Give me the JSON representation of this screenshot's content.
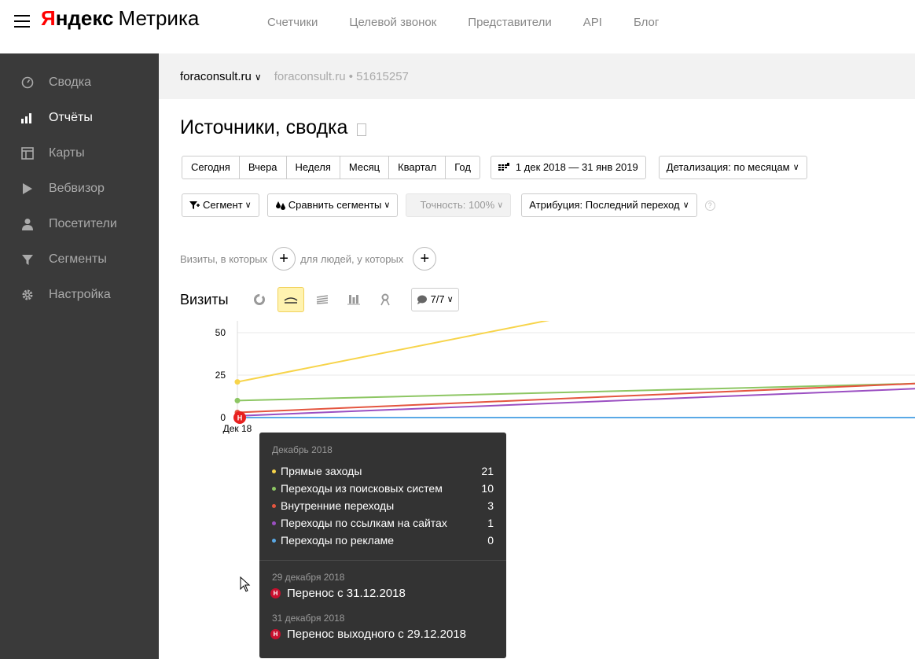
{
  "header": {
    "logo_ya": "Я",
    "logo_ndex": "ндекс",
    "logo_product": "Метрика",
    "nav": [
      "Счетчики",
      "Целевой звонок",
      "Представители",
      "API",
      "Блог"
    ]
  },
  "sidebar": {
    "items": [
      {
        "label": "Сводка",
        "icon": "gauge-icon",
        "active": false
      },
      {
        "label": "Отчёты",
        "icon": "bar-chart-icon",
        "active": true
      },
      {
        "label": "Карты",
        "icon": "map-icon",
        "active": false
      },
      {
        "label": "Вебвизор",
        "icon": "play-icon",
        "active": false
      },
      {
        "label": "Посетители",
        "icon": "person-icon",
        "active": false
      },
      {
        "label": "Сегменты",
        "icon": "funnel-icon",
        "active": false
      },
      {
        "label": "Настройка",
        "icon": "gear-icon",
        "active": false
      }
    ]
  },
  "counter": {
    "name": "foraconsult.ru",
    "info": "foraconsult.ru • 51615257"
  },
  "page": {
    "title": "Источники, сводка"
  },
  "periods": [
    "Сегодня",
    "Вчера",
    "Неделя",
    "Месяц",
    "Квартал",
    "Год"
  ],
  "date_range": "1 дек 2018 — 31 янв 2019",
  "detail": "Детализация: по месяцам",
  "filters": {
    "segment": "Сегмент",
    "compare": "Сравнить сегменты",
    "accuracy": "Точность: 100%",
    "attribution": "Атрибуция: Последний переход"
  },
  "conditions": {
    "visits_label": "Визиты, в которых",
    "people_label": "для людей, у которых"
  },
  "chart_toolbar": {
    "title": "Визиты",
    "series_count": "7/7"
  },
  "colors": {
    "direct": "#f7d44a",
    "search": "#8dc663",
    "internal": "#e4553f",
    "links": "#9b4fc2",
    "ads": "#5aa9e6",
    "sidebar_bg": "#3a3a3a",
    "highlight": "#fff3b0"
  },
  "chart_data": {
    "type": "line",
    "ylim": [
      0,
      175
    ],
    "y_ticks": [
      0,
      25,
      50,
      75,
      100,
      125,
      150,
      175
    ],
    "x_ticks": [
      "Дек 18"
    ],
    "series": [
      {
        "name": "Прямые заходы",
        "color": "#f7d44a",
        "values": [
          21,
          100
        ]
      },
      {
        "name": "Переходы из поисковых систем",
        "color": "#8dc663",
        "values": [
          10,
          20
        ]
      },
      {
        "name": "Внутренние переходы",
        "color": "#e4553f",
        "values": [
          3,
          20
        ]
      },
      {
        "name": "Переходы по ссылкам на сайтах",
        "color": "#9b4fc2",
        "values": [
          1,
          17
        ]
      },
      {
        "name": "Переходы по рекламе",
        "color": "#5aa9e6",
        "values": [
          0,
          0
        ]
      }
    ]
  },
  "tooltip": {
    "month": "Декабрь 2018",
    "rows": [
      {
        "label": "Прямые заходы",
        "value": "21",
        "color": "#f7d44a"
      },
      {
        "label": "Переходы из поисковых систем",
        "value": "10",
        "color": "#8dc663"
      },
      {
        "label": "Внутренние переходы",
        "value": "3",
        "color": "#e4553f"
      },
      {
        "label": "Переходы по ссылкам на сайтах",
        "value": "1",
        "color": "#9b4fc2"
      },
      {
        "label": "Переходы по рекламе",
        "value": "0",
        "color": "#5aa9e6"
      }
    ],
    "holidays": [
      {
        "date": "29 декабря 2018",
        "text": "Перенос с 31.12.2018",
        "badge": "Н"
      },
      {
        "date": "31 декабря 2018",
        "text": "Перенос выходного с 29.12.2018",
        "badge": "Н"
      }
    ]
  },
  "chart_marker": "Н"
}
